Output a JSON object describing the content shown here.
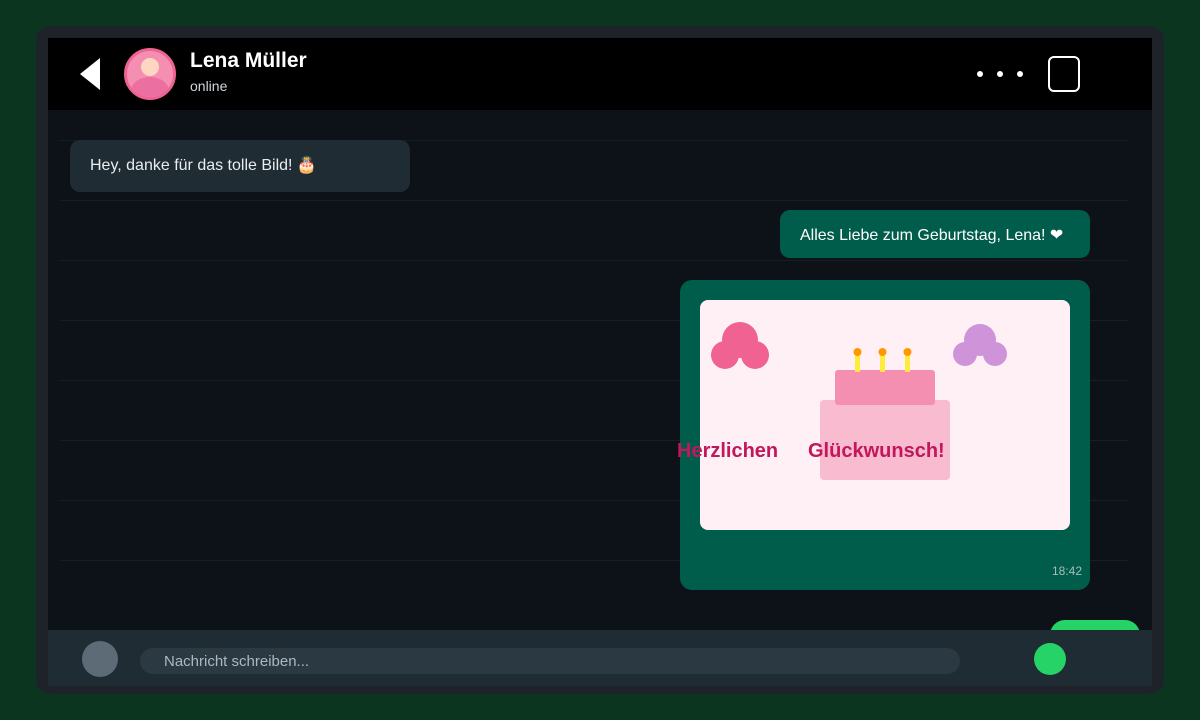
{
  "header": {
    "contact_name": "Lena Müller",
    "contact_status": "online",
    "icons": [
      "back-arrow-icon",
      "more-options-icon",
      "square-icon"
    ]
  },
  "messages": [
    {
      "direction": "incoming",
      "text": "Hey, danke für das tolle Bild! 🎂"
    },
    {
      "direction": "outgoing",
      "text": "Alles Liebe zum Geburtstag, Lena! ❤"
    },
    {
      "direction": "outgoing",
      "type": "image",
      "image_text_left": "Herzlichen",
      "image_text_right": "Glückwunsch!",
      "time": "18:42"
    }
  ],
  "input": {
    "placeholder": "Nachricht schreiben..."
  },
  "colors": {
    "header_bg": "#000000",
    "chat_bg": "#0c1218",
    "incoming_bubble": "#1f2c34",
    "outgoing_bubble": "#005c4b",
    "accent_green": "#25d366",
    "card_text": "#c2185b",
    "frame_bg": "#0c3520"
  }
}
